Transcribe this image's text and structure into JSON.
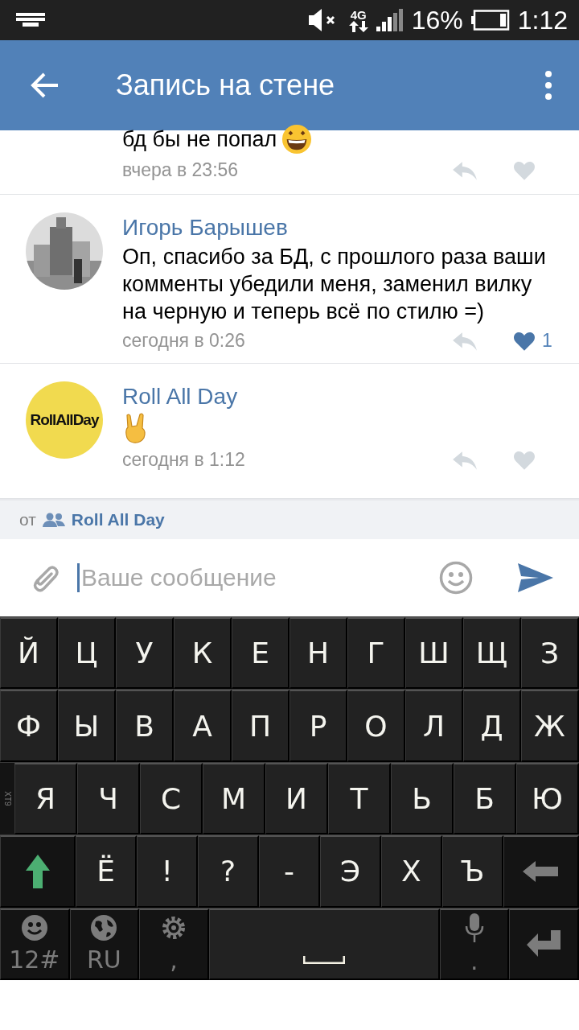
{
  "status_bar": {
    "network": "4G",
    "battery": "16%",
    "time": "1:12"
  },
  "header": {
    "title": "Запись на стене"
  },
  "comments": [
    {
      "text": "бд бы не попал",
      "time": "вчера в 23:56",
      "liked": false
    },
    {
      "author": "Игорь Барышев",
      "text": "Оп, спасибо за БД, с прошлого раза ваши комменты убедили меня, заменил вилку на черную и теперь всё по стилю =)",
      "time": "сегодня в 0:26",
      "liked": true,
      "likes": "1"
    },
    {
      "author": "Roll All Day",
      "avatar": {
        "kind": "logo",
        "text": "RollAllDay"
      },
      "time": "сегодня в 1:12",
      "liked": false
    }
  ],
  "sender": {
    "prefix": "от",
    "name": "Roll All Day"
  },
  "composer": {
    "placeholder": "Ваше сообщение"
  },
  "keyboard": {
    "side_label": "XT9",
    "rows": [
      {
        "keys": [
          "Й",
          "Ц",
          "У",
          "К",
          "Е",
          "Н",
          "Г",
          "Ш",
          "Щ",
          "З"
        ]
      },
      {
        "keys": [
          "Ф",
          "Ы",
          "В",
          "А",
          "П",
          "Р",
          "О",
          "Л",
          "Д",
          "Ж"
        ]
      },
      {
        "keys": [
          "Я",
          "Ч",
          "С",
          "М",
          "И",
          "Т",
          "Ь",
          "Б",
          "Ю"
        ]
      },
      {
        "keys": [
          "Ё",
          "!",
          "?",
          "-",
          "Э",
          "Х",
          "Ъ"
        ]
      }
    ],
    "bottom": [
      {
        "kind": "smiley",
        "label": "12#"
      },
      {
        "kind": "globe",
        "label": "RU"
      },
      {
        "kind": "gear",
        "label": ","
      },
      {
        "kind": "space"
      },
      {
        "kind": "mic",
        "label": "."
      },
      {
        "kind": "enter"
      }
    ]
  }
}
